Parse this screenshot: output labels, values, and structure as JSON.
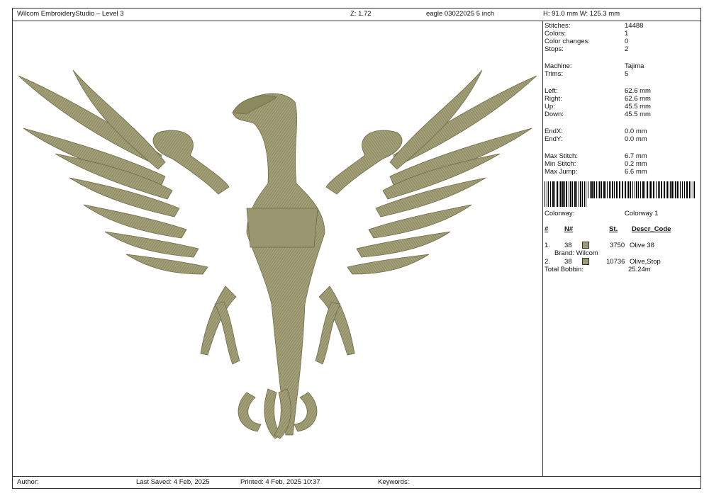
{
  "header": {
    "app_title": "Wilcom EmbroideryStudio – Level 3",
    "zoom": "Z: 1.72",
    "design_name": "eagle 03022025 5 inch",
    "dimensions": "H: 91.0 mm   W: 125.3 mm"
  },
  "stats": {
    "stitches_label": "Stitches:",
    "stitches": "14488",
    "colors_label": "Colors:",
    "colors": "1",
    "color_changes_label": "Color changes:",
    "color_changes": "0",
    "stops_label": "Stops:",
    "stops": "2",
    "machine_label": "Machine:",
    "machine": "Tajima",
    "trims_label": "Trims:",
    "trims": "5",
    "left_label": "Left:",
    "left": "62.6 mm",
    "right_label": "Right:",
    "right": "62.6 mm",
    "up_label": "Up:",
    "up": "45.5 mm",
    "down_label": "Down:",
    "down": "45.5 mm",
    "endx_label": "EndX:",
    "endx": "0.0 mm",
    "endy_label": "EndY:",
    "endy": "0.0 mm",
    "max_stitch_label": "Max Stitch:",
    "max_stitch": "6.7 mm",
    "min_stitch_label": "Min Stitch:",
    "min_stitch": "0.2 mm",
    "max_jump_label": "Max Jump:",
    "max_jump": "6.6 mm"
  },
  "colorway": {
    "label": "Colorway:",
    "value": "Colorway 1",
    "headers": {
      "num": "#",
      "n": "N#",
      "st": "St.",
      "descr": "Descr_Code"
    },
    "rows": [
      {
        "num": "1.",
        "n": "38",
        "st": "3750",
        "descr": "Olive 38",
        "color": "#9e9b73"
      },
      {
        "num": "2.",
        "n": "38",
        "st": "10736",
        "descr": "Olive,Stop",
        "color": "#9e9b73"
      }
    ],
    "brand": "Brand: Wilcom",
    "total_bobbin_label": "Total Bobbin:",
    "total_bobbin": "25.24m"
  },
  "footer": {
    "author": "Author:",
    "last_saved": "Last Saved:  4 Feb, 2025",
    "printed": "Printed:  4 Feb, 2025 10:37",
    "keywords": "Keywords:"
  },
  "colors": {
    "thread": "#9e9b73",
    "thread_dark": "#6e6b48",
    "thread_light": "#c0bd95"
  }
}
